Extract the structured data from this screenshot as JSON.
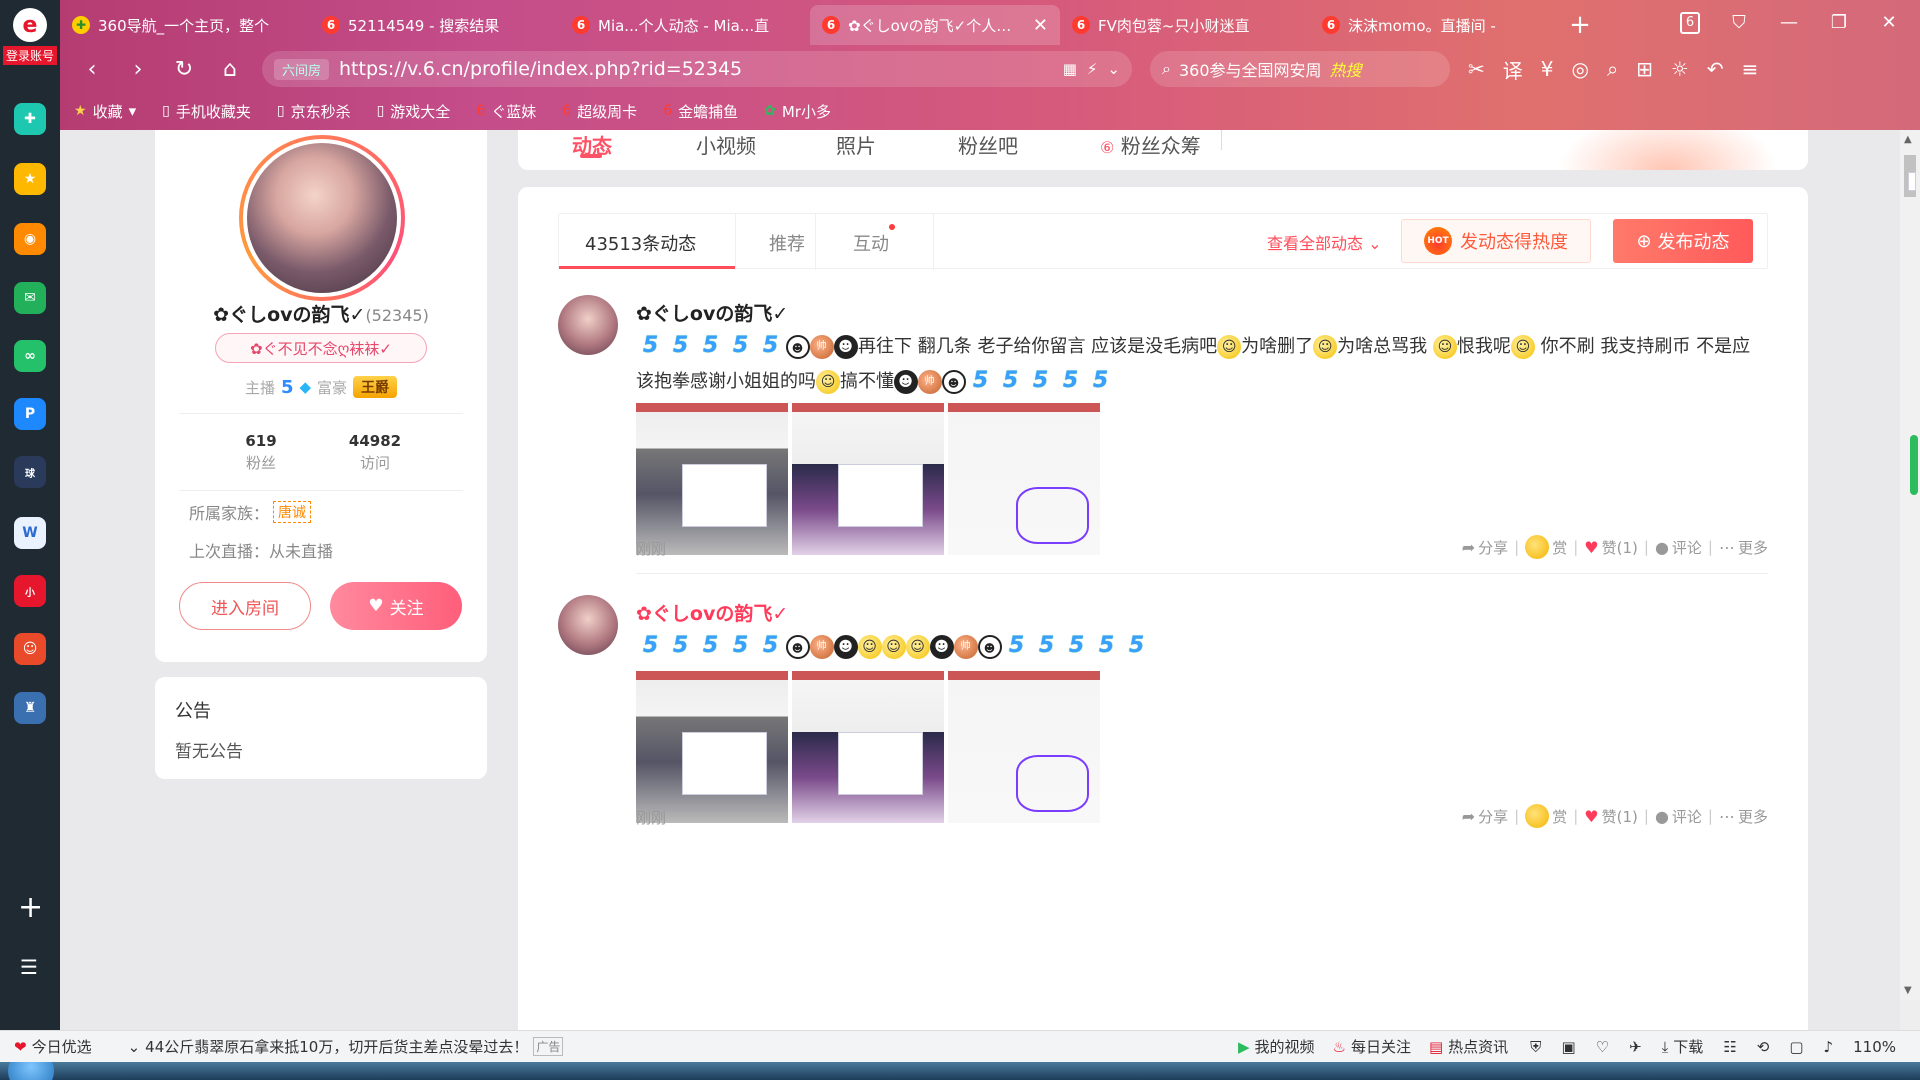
{
  "browser": {
    "tabs": [
      {
        "title": "360导航_一个主页，整个",
        "icon": "nav"
      },
      {
        "title": "52114549 - 搜索结果",
        "icon": "6"
      },
      {
        "title": "Mia...个人动态 - Mia...直",
        "icon": "6"
      },
      {
        "title": "✿ぐしovの韵飞✓个人动态",
        "icon": "6",
        "active": true
      },
      {
        "title": "FV肉包蓉~只小财迷直",
        "icon": "6"
      },
      {
        "title": "沫沫momo。直播间 -",
        "icon": "6"
      }
    ],
    "tab_count": "6",
    "address": {
      "secure_label": "六间房",
      "url": "https://v.6.cn/profile/index.php?rid=52345"
    },
    "search": {
      "text": "360参与全国网安周",
      "hot": "热搜"
    },
    "bookmarks": [
      {
        "label": "收藏",
        "icon": "star"
      },
      {
        "label": "手机收藏夹",
        "icon": "doc"
      },
      {
        "label": "京东秒杀",
        "icon": "doc"
      },
      {
        "label": "游戏大全",
        "icon": "doc"
      },
      {
        "label": "ぐ蓝妹",
        "icon": "6"
      },
      {
        "label": "超级周卡",
        "icon": "6"
      },
      {
        "label": "金蟾捕鱼",
        "icon": "6"
      },
      {
        "label": "Mr小多",
        "icon": "leaf"
      }
    ]
  },
  "sidebar": {
    "login_label": "登录账号"
  },
  "profile": {
    "name": "✿ぐしovの韵飞✓",
    "rid": "(52345)",
    "tag": "✿ぐ不见不念ღ袜袜✓",
    "anchor_label": "主播",
    "anchor_level": "5",
    "rich_label": "富豪",
    "rich_badge": "王爵",
    "fans_count": "619",
    "fans_label": "粉丝",
    "visits_count": "44982",
    "visits_label": "访问",
    "family_label": "所属家族：",
    "family_badge": "唐诚",
    "last_live": "上次直播：从未直播",
    "enter_room": "进入房间",
    "follow": "关注"
  },
  "notice": {
    "title": "公告",
    "text": "暂无公告"
  },
  "main_tabs": {
    "items": [
      "动态",
      "小视频",
      "照片",
      "粉丝吧",
      "粉丝众筹"
    ]
  },
  "feed": {
    "subtabs": [
      "43513条动态",
      "推荐",
      "互动"
    ],
    "view_all": "查看全部动态",
    "hot_button": "发动态得热度",
    "hot_icon_text": "HOT",
    "publish_button": "发布动态",
    "posts": [
      {
        "name": "✿ぐしovの韵飞✓",
        "text_a": "再往下 翻几条 老子给你留言 应该是没毛病吧",
        "text_b": "为啥删了",
        "text_c": "为啥总骂我",
        "text_d": "恨我呢",
        "text_e": "你不刷 我支持刷币 不是应该抱拳感谢小姐姐的吗",
        "text_f": "搞不懂",
        "time": "刚刚"
      },
      {
        "name": "✿ぐしovの韵飞✓",
        "time": "刚刚"
      }
    ],
    "actions": {
      "share": "分享",
      "reward": "赏",
      "like": "赞(1)",
      "comment": "评论",
      "more": "更多"
    }
  },
  "statusbar": {
    "today": "今日优选",
    "news": "44公斤翡翠原石拿来抵10万，切开后货主差点没晕过去！",
    "ad": "广告",
    "my_video": "我的视频",
    "daily": "每日关注",
    "hotnews": "热点资讯",
    "download": "下载",
    "zoom": "110%"
  }
}
